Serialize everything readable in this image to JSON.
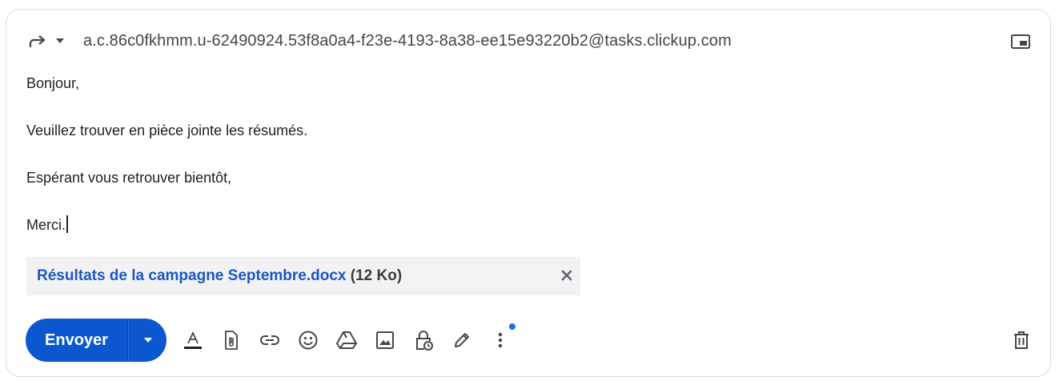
{
  "header": {
    "reply_mode_icon": "forward-icon",
    "reply_mode_menu_icon": "caret-down-icon",
    "recipient": "a.c.86c0fkhmm.u-62490924.53f8a0a4-f23e-4193-8a38-ee15e93220b2@tasks.clickup.com",
    "popout_icon": "pop-out-icon"
  },
  "message": {
    "lines": [
      "Bonjour,",
      "Veuillez trouver en pièce jointe les résumés.",
      "Espérant vous retrouver bientôt,",
      "Merci."
    ]
  },
  "attachment": {
    "name": "Résultats de la campagne Septembre.docx",
    "size": "(12 Ko)",
    "remove_icon": "close-icon"
  },
  "toolbar": {
    "send_label": "Envoyer",
    "icons": [
      "format-text-icon",
      "attach-file-icon",
      "insert-link-icon",
      "insert-emoji-icon",
      "google-drive-icon",
      "insert-photo-icon",
      "confidential-mode-icon",
      "signature-icon",
      "more-options-icon",
      "discard-draft-icon"
    ]
  },
  "colors": {
    "accent": "#0b57d0",
    "attachment_link": "#1a57c6",
    "notification_dot": "#1a73e8"
  }
}
